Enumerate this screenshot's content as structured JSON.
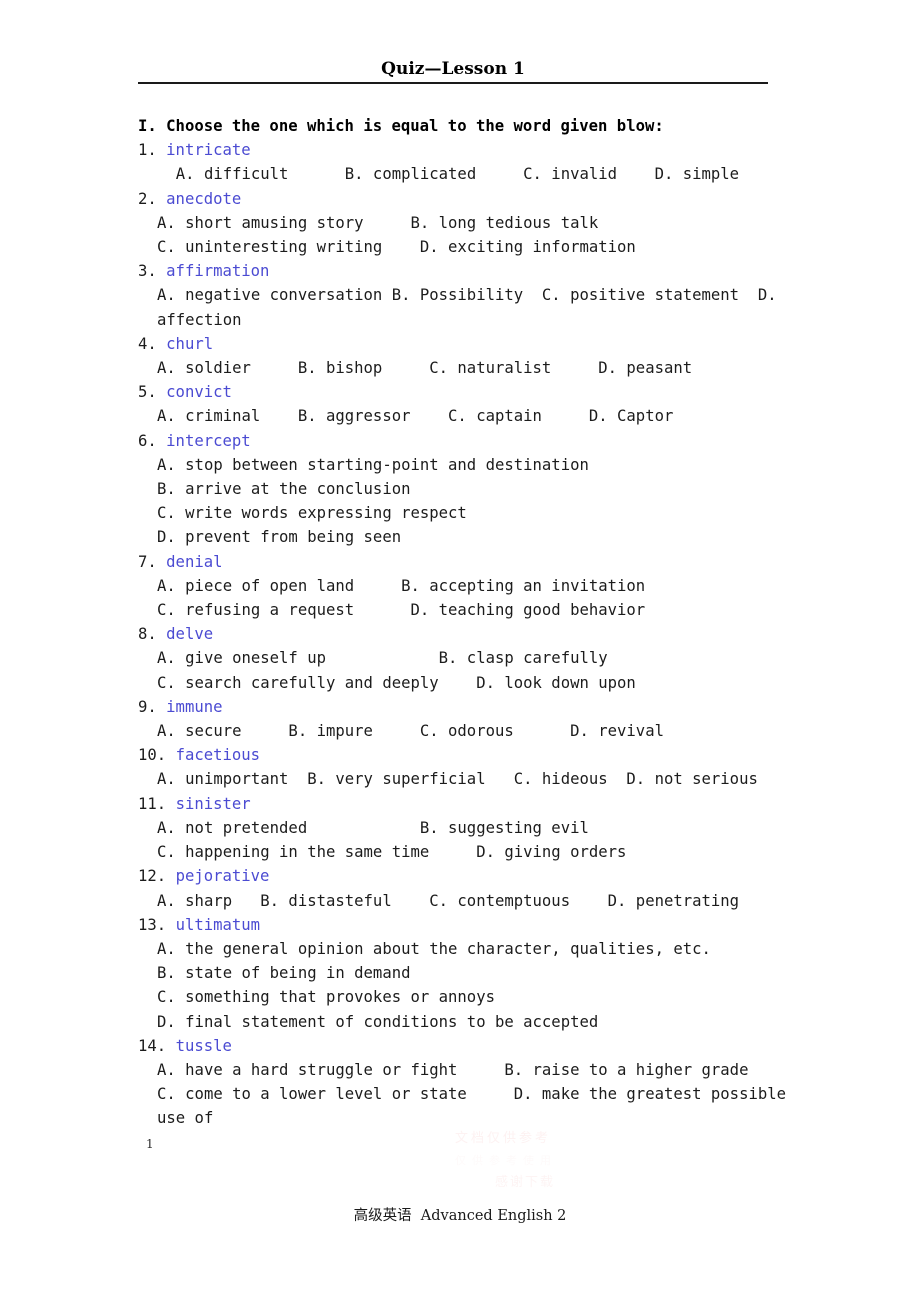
{
  "header": {
    "title": "Quiz—Lesson 1"
  },
  "section": {
    "heading": "I. Choose the one which is equal to the word given blow:"
  },
  "accent_color": "#4b4bd2",
  "items": [
    {
      "number": "1.",
      "word": "intricate",
      "lines": [
        "  A. difficult      B. complicated     C. invalid    D. simple"
      ]
    },
    {
      "number": "2.",
      "word": "anecdote",
      "lines": [
        "A. short amusing story     B. long tedious talk",
        "C. uninteresting writing    D. exciting information"
      ]
    },
    {
      "number": "3.",
      "word": "affirmation",
      "lines": [
        "A. negative conversation B. Possibility  C. positive statement  D. affection"
      ]
    },
    {
      "number": "4.",
      "word": "churl",
      "lines": [
        "A. soldier     B. bishop     C. naturalist     D. peasant"
      ]
    },
    {
      "number": "5.",
      "word": "convict",
      "lines": [
        "A. criminal    B. aggressor    C. captain     D. Captor"
      ]
    },
    {
      "number": "6.",
      "word": "intercept",
      "lines": [
        "A. stop between starting-point and destination",
        "B. arrive at the conclusion",
        "C. write words expressing respect",
        "D. prevent from being seen"
      ]
    },
    {
      "number": "7.",
      "word": "denial",
      "lines": [
        "A. piece of open land     B. accepting an invitation",
        "C. refusing a request      D. teaching good behavior"
      ]
    },
    {
      "number": "8.",
      "word": "delve",
      "lines": [
        "A. give oneself up            B. clasp carefully",
        "C. search carefully and deeply    D. look down upon"
      ]
    },
    {
      "number": "9.",
      "word": "immune",
      "lines": [
        "A. secure     B. impure     C. odorous      D. revival"
      ]
    },
    {
      "number": "10.",
      "word": "facetious",
      "lines": [
        "A. unimportant  B. very superficial   C. hideous  D. not serious"
      ]
    },
    {
      "number": "11.",
      "word": "sinister",
      "lines": [
        "A. not pretended            B. suggesting evil",
        "C. happening in the same time     D. giving orders"
      ]
    },
    {
      "number": "12.",
      "word": "pejorative",
      "lines": [
        "A. sharp   B. distasteful    C. contemptuous    D. penetrating"
      ]
    },
    {
      "number": "13.",
      "word": "ultimatum",
      "lines": [
        "A. the general opinion about the character, qualities, etc.",
        "B. state of being in demand",
        "C. something that provokes or annoys",
        "D. final statement of conditions to be accepted"
      ]
    },
    {
      "number": "14.",
      "word": "tussle",
      "lines": [
        "A. have a hard struggle or fight     B. raise to a higher grade",
        "C. come to a lower level or state     D. make the greatest possible use of"
      ]
    }
  ],
  "page_number": "1",
  "footer": {
    "text": "高级英语  Advanced English 2"
  },
  "watermark": {
    "line1": "文档仅供参考",
    "line2": "仅供参考使用",
    "line3": "感谢下载"
  }
}
